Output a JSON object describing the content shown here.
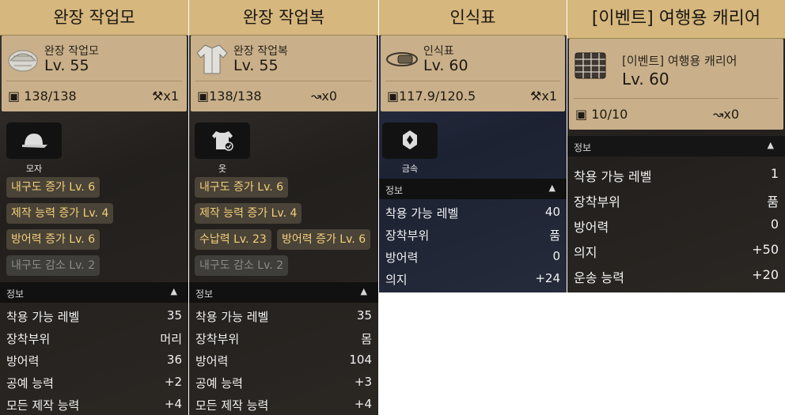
{
  "panels": [
    {
      "title": "완장 작업모",
      "item_name": "완장 작업모",
      "level": "Lv. 55",
      "durability": "138/138",
      "repair": "x1",
      "category": "모자",
      "tags": [
        "내구도 증가 Lv. 6",
        "제작 능력 증가 Lv. 4",
        "방어력 증가 Lv. 6",
        "내구도 감소 Lv. 2"
      ],
      "info_label": "정보",
      "info_arrow": "▲",
      "stats": [
        {
          "k": "착용 가능 레벨",
          "v": "35"
        },
        {
          "k": "장착부위",
          "v": "머리"
        },
        {
          "k": "방어력",
          "v": "36"
        },
        {
          "k": "공예 능력",
          "v": "+2"
        },
        {
          "k": "모든 제작 능력",
          "v": "+4"
        }
      ]
    },
    {
      "title": "완장 작업복",
      "item_name": "완장 작업복",
      "level": "Lv. 55",
      "durability": "138/138",
      "repair": "x0",
      "category": "옷",
      "tags": [
        "내구도 증가 Lv. 6",
        "제작 능력 증가 Lv. 4",
        "수납력 Lv. 23",
        "방어력 증가 Lv. 6",
        "내구도 감소 Lv. 2"
      ],
      "info_label": "정보",
      "info_arrow": "▲",
      "stats": [
        {
          "k": "착용 가능 레벨",
          "v": "35"
        },
        {
          "k": "장착부위",
          "v": "몸"
        },
        {
          "k": "방어력",
          "v": "104"
        },
        {
          "k": "공예 능력",
          "v": "+3"
        },
        {
          "k": "모든 제작 능력",
          "v": "+4"
        }
      ]
    },
    {
      "title": "인식표",
      "item_name": "인식표",
      "level": "Lv. 60",
      "durability": "117.9/120.5",
      "repair": "x1",
      "category": "금속",
      "info_label": "정보",
      "info_arrow": "▲",
      "stats": [
        {
          "k": "착용 가능 레벨",
          "v": "40"
        },
        {
          "k": "장착부위",
          "v": "품"
        },
        {
          "k": "방어력",
          "v": "0"
        },
        {
          "k": "의지",
          "v": "+24"
        }
      ]
    },
    {
      "title": "[이벤트] 여행용 캐리어",
      "item_name": "[이벤트] 여행용 캐리어",
      "level": "Lv. 60",
      "durability": "10/10",
      "repair": "x0",
      "info_label": "정보",
      "info_arrow": "▲",
      "stats": [
        {
          "k": "착용 가능 레벨",
          "v": "1"
        },
        {
          "k": "장착부위",
          "v": "품"
        },
        {
          "k": "방어력",
          "v": "0"
        },
        {
          "k": "의지",
          "v": "+50"
        },
        {
          "k": "운송 능력",
          "v": "+20"
        }
      ]
    }
  ]
}
